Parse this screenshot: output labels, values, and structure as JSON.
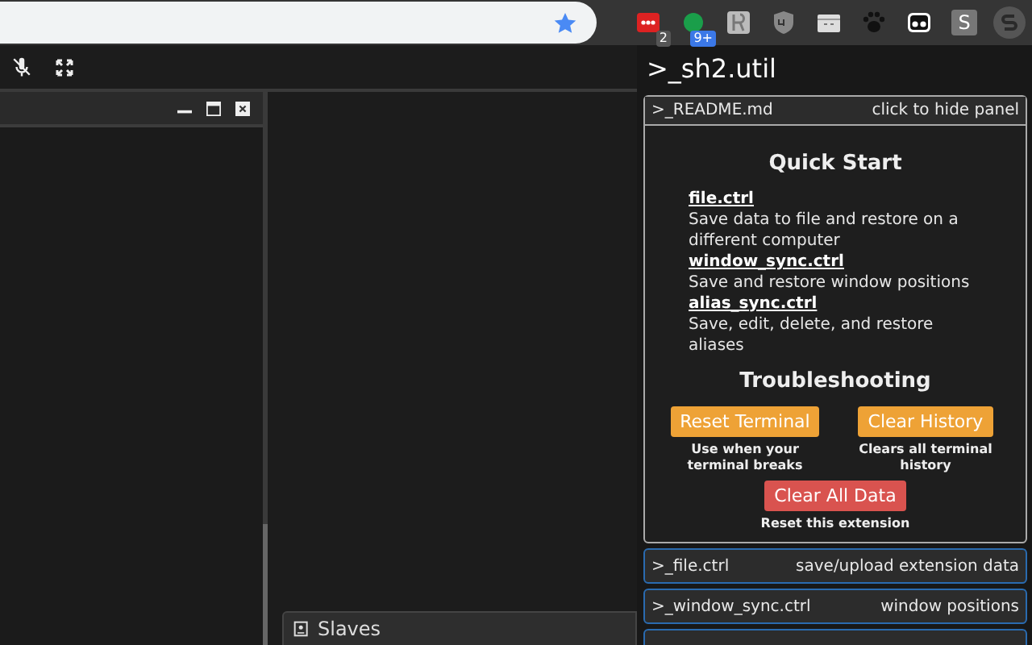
{
  "extensions": [
    {
      "kind": "dots",
      "badge": "2"
    },
    {
      "kind": "dot",
      "badge": "9+"
    },
    {
      "kind": "glyph"
    },
    {
      "kind": "shield"
    },
    {
      "kind": "face"
    },
    {
      "kind": "paw"
    },
    {
      "kind": "eyes"
    },
    {
      "kind": "letter",
      "label": "S"
    },
    {
      "kind": "avatar"
    }
  ],
  "dock": {
    "tab": "Slaves"
  },
  "panel": {
    "title": ">_sh2.util",
    "readme": {
      "name": ">_README.md",
      "hint": "click to hide panel",
      "heading": "Quick Start",
      "items": [
        {
          "link": "file.ctrl",
          "desc": "Save data to file and restore on a different computer"
        },
        {
          "link": "window_sync.ctrl",
          "desc": "Save and restore window positions"
        },
        {
          "link": "alias_sync.ctrl",
          "desc": "Save, edit, delete, and restore aliases"
        }
      ],
      "trouble_heading": "Troubleshooting",
      "actions": [
        {
          "label": "Reset Terminal",
          "note": "Use when your terminal breaks",
          "kind": "warning"
        },
        {
          "label": "Clear History",
          "note": "Clears all terminal history",
          "kind": "warning"
        },
        {
          "label": "Clear All Data",
          "note": "Reset this extension",
          "kind": "danger"
        }
      ]
    },
    "sections": [
      {
        "name": ">_file.ctrl",
        "hint": "save/upload extension data"
      },
      {
        "name": ">_window_sync.ctrl",
        "hint": "window positions"
      }
    ]
  }
}
